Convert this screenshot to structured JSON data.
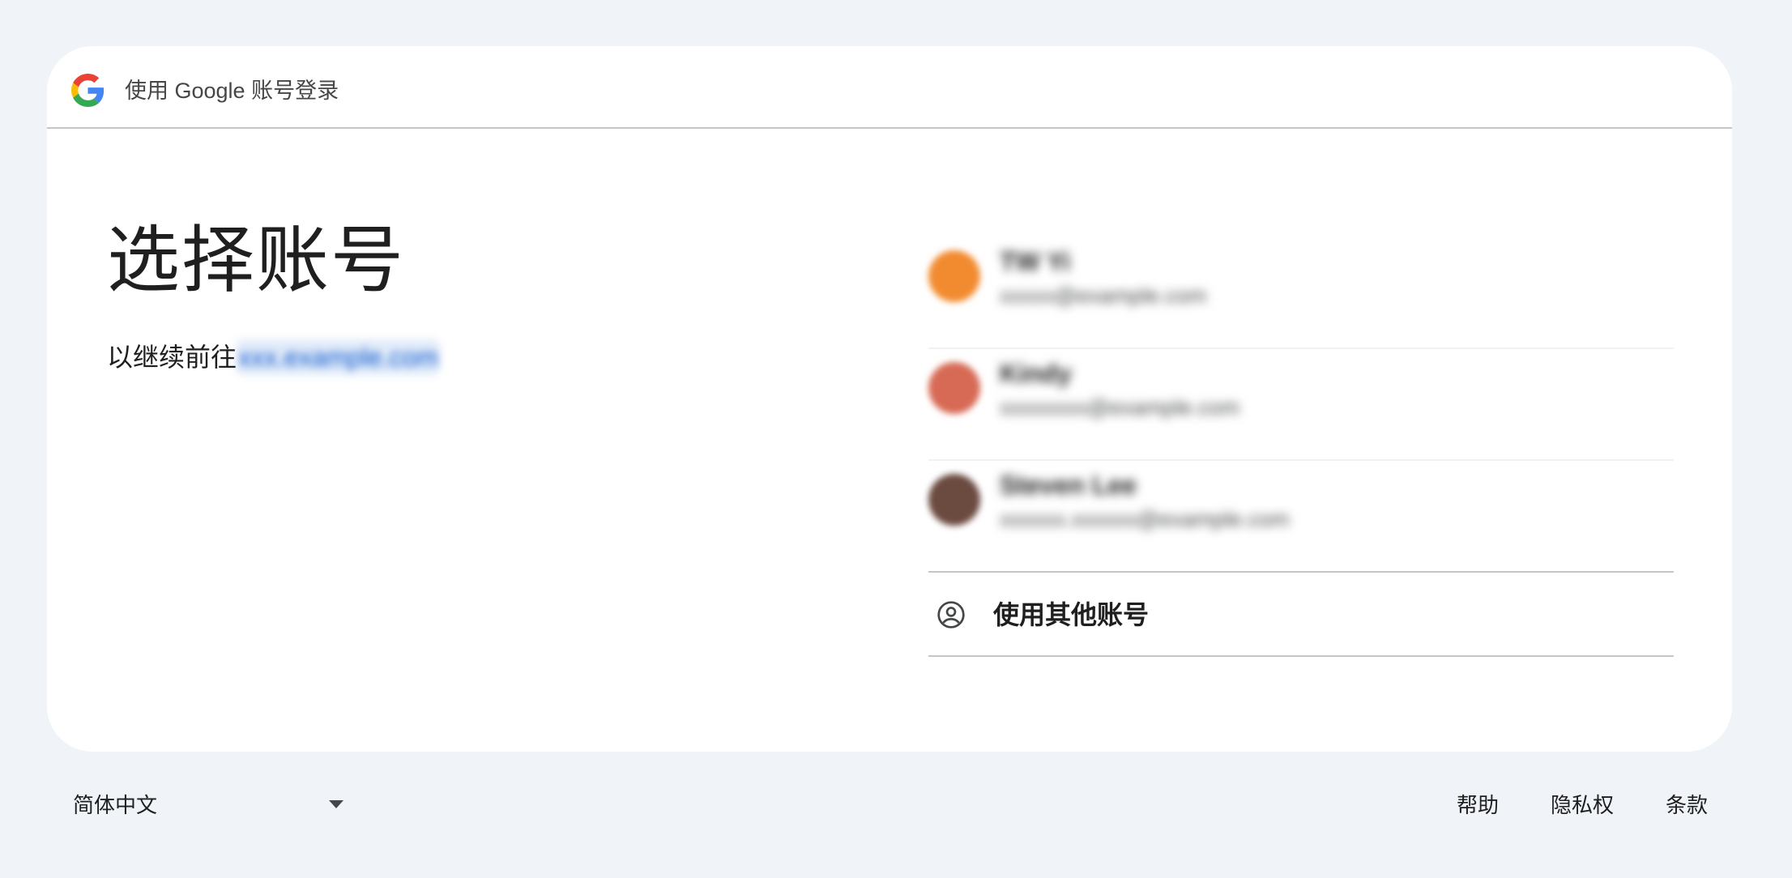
{
  "header": {
    "title": "使用 Google 账号登录",
    "logo_icon": "google-g-icon"
  },
  "main": {
    "heading": "选择账号",
    "subtitle_prefix": "以继续前往",
    "subtitle_link": "xxx.example.com"
  },
  "accounts": [
    {
      "name": "TW Yi",
      "email": "xxxxx@example.com",
      "avatar_color": "#f28b30"
    },
    {
      "name": "Kindy",
      "email": "xxxxxxxx@example.com",
      "avatar_color": "#d76a55"
    },
    {
      "name": "Steven Lee",
      "email": "xxxxxx.xxxxxx@example.com",
      "avatar_color": "#6b4a40"
    }
  ],
  "use_other": {
    "label": "使用其他账号",
    "icon": "account-circle-icon"
  },
  "footer": {
    "language": "简体中文",
    "links": [
      "帮助",
      "隐私权",
      "条款"
    ]
  },
  "colors": {
    "background": "#f0f4f9",
    "card": "#ffffff",
    "link": "#0b57d0",
    "divider": "#c4c7c5"
  }
}
